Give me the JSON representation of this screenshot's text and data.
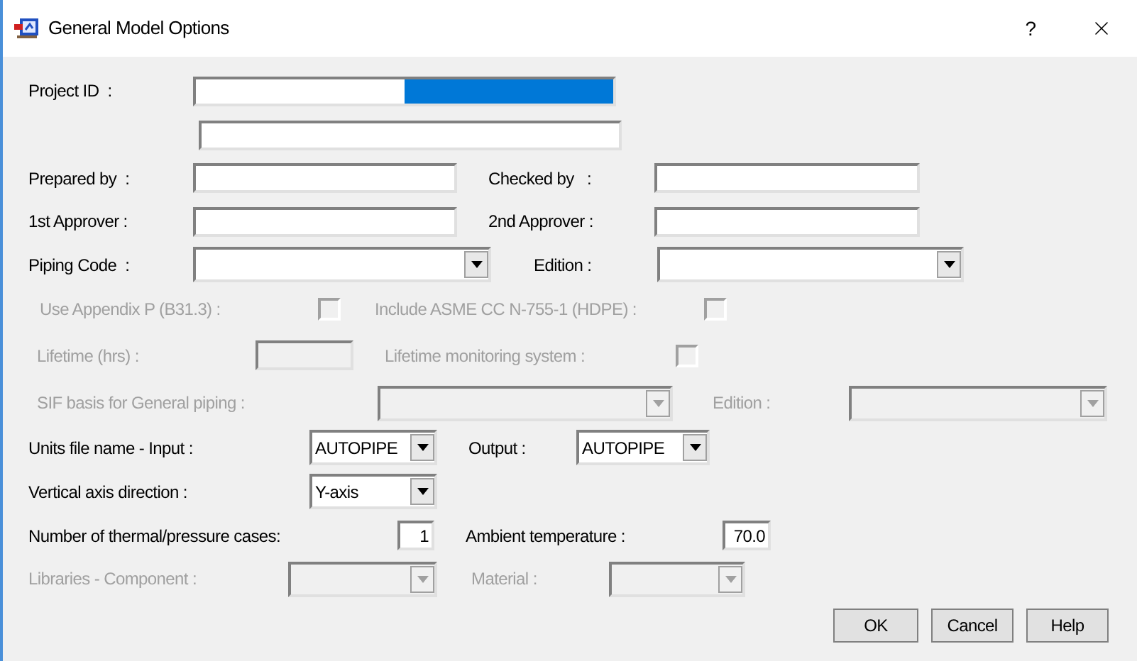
{
  "window": {
    "title": "General Model Options",
    "help": "?"
  },
  "rows": [
    {
      "items": [
        {
          "kind": "label",
          "text": "Project ID  :",
          "disabled": false
        },
        {
          "kind": "text",
          "disabled": false,
          "highlighted": true
        }
      ]
    },
    {
      "items": [
        {
          "kind": "text",
          "disabled": false,
          "highlighted": false
        }
      ]
    },
    {
      "items": [
        {
          "kind": "label",
          "text": "Prepared by  :",
          "disabled": false
        },
        {
          "kind": "text",
          "disabled": false,
          "highlighted": false
        },
        {
          "kind": "label",
          "text": "Checked by   :",
          "disabled": false
        },
        {
          "kind": "text",
          "disabled": false,
          "highlighted": false
        }
      ]
    },
    {
      "items": [
        {
          "kind": "label",
          "text": "1st Approver :",
          "disabled": false
        },
        {
          "kind": "text",
          "disabled": false,
          "highlighted": false
        },
        {
          "kind": "label",
          "text": "2nd Approver :",
          "disabled": false
        },
        {
          "kind": "text",
          "disabled": false,
          "highlighted": false
        }
      ]
    },
    {
      "items": [
        {
          "kind": "label",
          "text": "Piping Code  :",
          "disabled": false
        },
        {
          "kind": "combo",
          "disabled": false
        },
        {
          "kind": "label",
          "text": "Edition :",
          "disabled": false
        },
        {
          "kind": "combo",
          "disabled": false
        }
      ]
    },
    {
      "items": [
        {
          "kind": "label",
          "text": "Use Appendix P (B31.3) :",
          "disabled": true
        },
        {
          "kind": "checkbox",
          "checked": false,
          "disabled": true
        },
        {
          "kind": "label",
          "text": "Include ASME CC N-755-1 (HDPE) :",
          "disabled": true
        },
        {
          "kind": "checkbox",
          "checked": false,
          "disabled": true
        }
      ]
    },
    {
      "items": [
        {
          "kind": "label",
          "text": "Lifetime (hrs) :",
          "disabled": true
        },
        {
          "kind": "text",
          "disabled": true,
          "highlighted": false
        },
        {
          "kind": "label",
          "text": "Lifetime monitoring system :",
          "disabled": true
        },
        {
          "kind": "checkbox",
          "checked": false,
          "disabled": true
        }
      ]
    },
    {
      "items": [
        {
          "kind": "label",
          "text": "SIF basis for General piping :",
          "disabled": true
        },
        {
          "kind": "combo",
          "disabled": true
        },
        {
          "kind": "label",
          "text": "Edition :",
          "disabled": true
        },
        {
          "kind": "combo",
          "disabled": true
        }
      ]
    },
    {
      "items": [
        {
          "kind": "label",
          "text": "Units file name - Input :",
          "disabled": false
        },
        {
          "kind": "combo",
          "value": "AUTOPIPE",
          "disabled": false
        },
        {
          "kind": "label",
          "text": "Output :",
          "disabled": false
        },
        {
          "kind": "combo",
          "value": "AUTOPIPE",
          "disabled": false
        }
      ]
    },
    {
      "items": [
        {
          "kind": "label",
          "text": "Vertical axis direction :",
          "disabled": false
        },
        {
          "kind": "combo",
          "value": "Y-axis",
          "disabled": false
        }
      ]
    },
    {
      "items": [
        {
          "kind": "label",
          "text": "Number of thermal/pressure cases:",
          "disabled": false
        },
        {
          "kind": "number",
          "value": "1",
          "disabled": false
        },
        {
          "kind": "label",
          "text": "Ambient temperature :",
          "disabled": false
        },
        {
          "kind": "number",
          "value": "70.0",
          "disabled": false
        }
      ]
    },
    {
      "items": [
        {
          "kind": "label",
          "text": "Libraries - Component :",
          "disabled": true
        },
        {
          "kind": "combo",
          "disabled": true
        },
        {
          "kind": "label",
          "text": "Material :",
          "disabled": true
        },
        {
          "kind": "combo",
          "disabled": true
        }
      ]
    }
  ],
  "buttons": [
    "OK",
    "Cancel",
    "Help"
  ]
}
